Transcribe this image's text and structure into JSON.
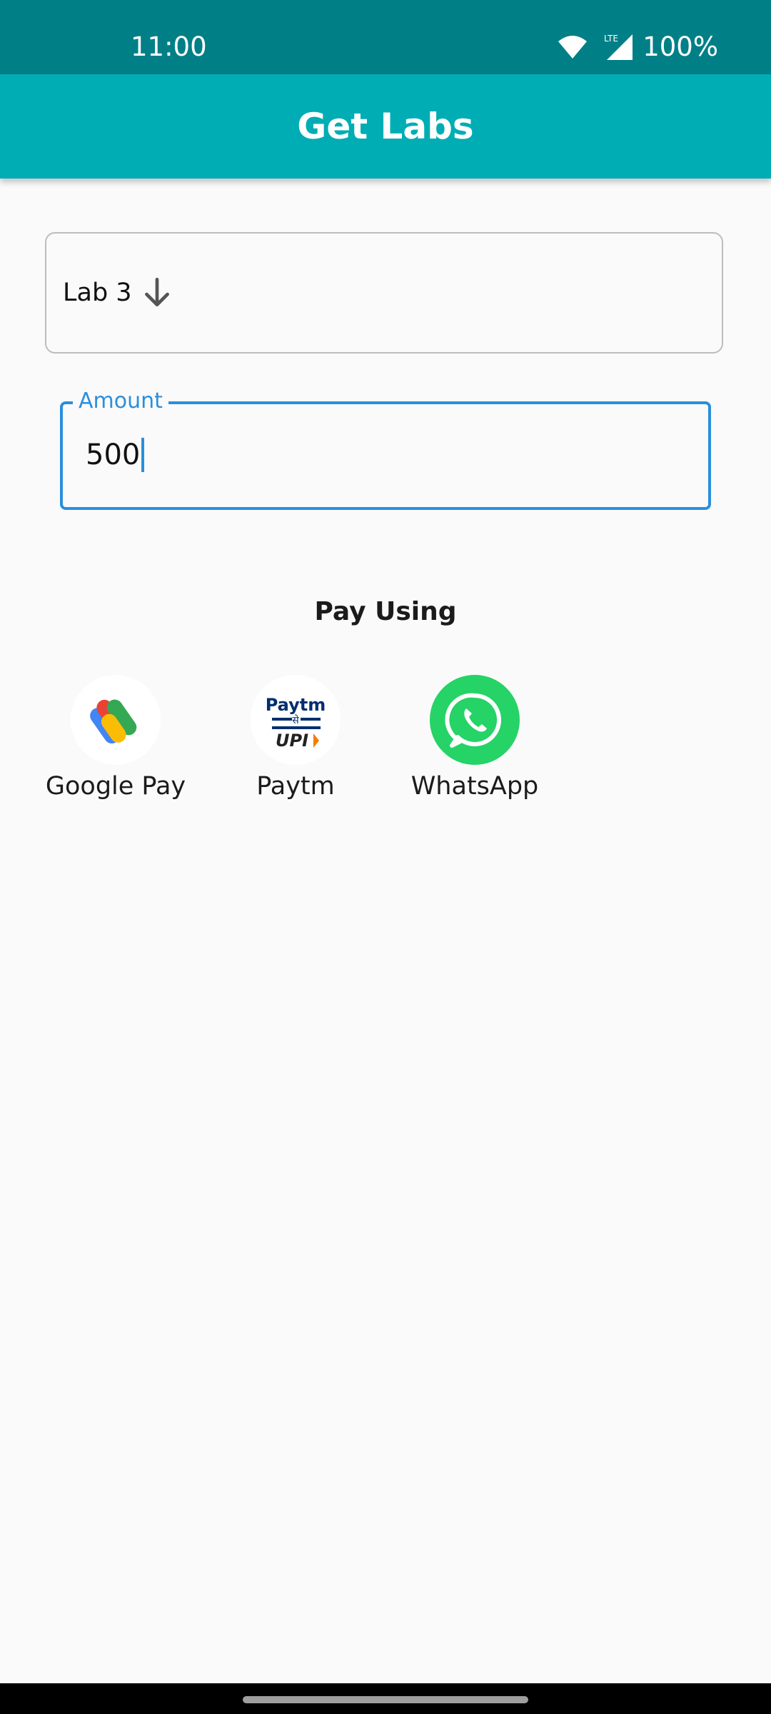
{
  "status_bar": {
    "time": "11:00",
    "battery": "100%",
    "network_label": "LTE",
    "icons": [
      "wifi-icon",
      "signal-icon"
    ]
  },
  "app_bar": {
    "title": "Get Labs",
    "color": "#00adb5"
  },
  "lab_select": {
    "value": "Lab 3",
    "icon": "arrow-down-icon"
  },
  "amount_field": {
    "label": "Amount",
    "value": "500",
    "accent": "#2b8fdc"
  },
  "pay_section": {
    "title": "Pay Using",
    "options": [
      {
        "label": "Google Pay",
        "icon": "google-pay-icon"
      },
      {
        "label": "Paytm",
        "icon": "paytm-icon",
        "logo_text_1": "Paytm",
        "logo_text_2": "से",
        "logo_text_3": "UPI"
      },
      {
        "label": "WhatsApp",
        "icon": "whatsapp-icon"
      }
    ]
  }
}
